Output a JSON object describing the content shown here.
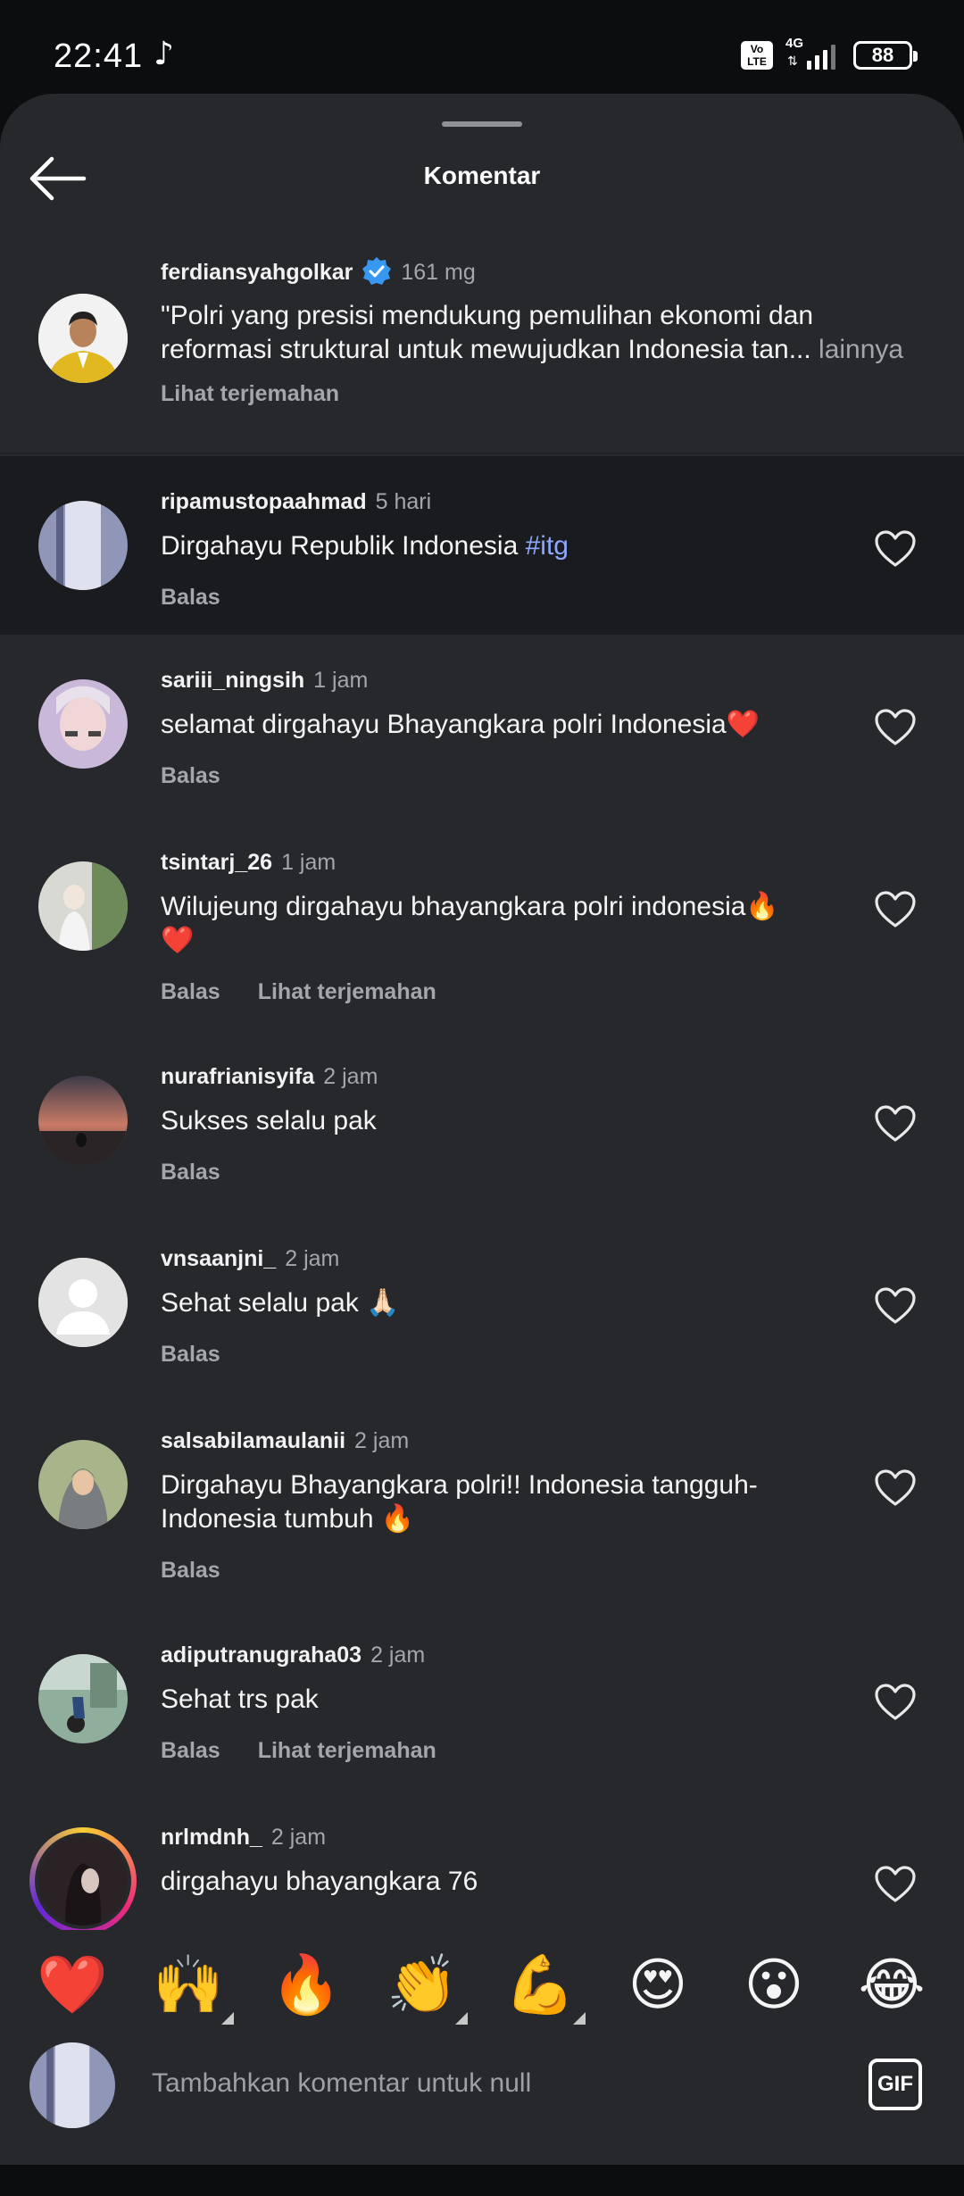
{
  "status_bar": {
    "time": "22:41",
    "network": "4G",
    "volte": "Vo LTE",
    "battery": "88"
  },
  "header": {
    "title": "Komentar"
  },
  "caption": {
    "username": "ferdiansyahgolkar",
    "time": "161 mg",
    "text_line1": "\"Polri yang presisi mendukung pemulihan ekonomi dan",
    "text_line2": "reformasi struktural untuk mewujudkan Indonesia tan...",
    "more": " lainnya",
    "translate": "Lihat terjemahan"
  },
  "comments": [
    {
      "username": "ripamustopaahmad",
      "time": "5 hari",
      "text": "Dirgahayu Republik Indonesia ",
      "tag": "#itg",
      "reply": "Balas"
    },
    {
      "username": "sariii_ningsih",
      "time": "1 jam",
      "text": "selamat dirgahayu Bhayangkara polri Indonesia❤️",
      "reply": "Balas"
    },
    {
      "username": "tsintarj_26",
      "time": "1 jam",
      "text_line1": "Wilujeung dirgahayu bhayangkara polri indonesia🔥",
      "text_line2": "❤️",
      "reply": "Balas",
      "translate": "Lihat terjemahan"
    },
    {
      "username": "nurafrianisyifa",
      "time": "2 jam",
      "text": "Sukses selalu pak",
      "reply": "Balas"
    },
    {
      "username": "vnsaanjni_",
      "time": "2 jam",
      "text": "Sehat selalu pak 🙏🏻",
      "reply": "Balas"
    },
    {
      "username": "salsabilamaulanii",
      "time": "2 jam",
      "text_line1": "Dirgahayu Bhayangkara polri!! Indonesia tangguh-",
      "text_line2": "Indonesia tumbuh 🔥",
      "reply": "Balas"
    },
    {
      "username": "adiputranugraha03",
      "time": "2 jam",
      "text": "Sehat trs pak",
      "reply": "Balas",
      "translate": "Lihat terjemahan"
    },
    {
      "username": "nrlmdnh_",
      "time": "2 jam",
      "text": "dirgahayu bhayangkara 76"
    }
  ],
  "quick_reactions": [
    "❤️",
    "🙌",
    "🔥",
    "👏",
    "💪",
    "😍",
    "😮",
    "😂"
  ],
  "composer": {
    "placeholder": "Tambahkan komentar untuk null",
    "gif_label": "GIF"
  },
  "colors": {
    "sheet_bg": "#26282c",
    "highlight_bg": "#1a1b1e",
    "hashtag": "#8ea8ff",
    "muted_text": "#a4a6ab",
    "verified": "#3897f0"
  }
}
